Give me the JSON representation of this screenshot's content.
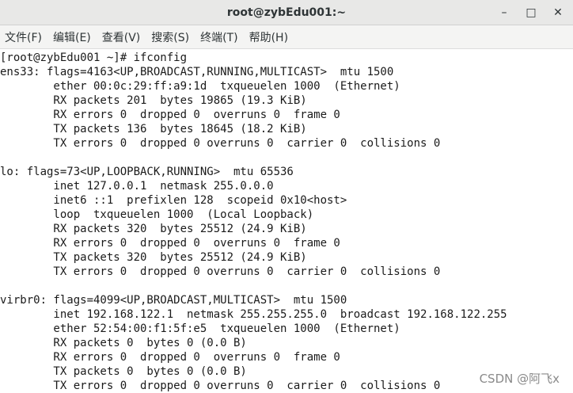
{
  "window": {
    "title": "root@zybEdu001:~",
    "minimize_glyph": "–",
    "maximize_glyph": "□",
    "close_glyph": "✕"
  },
  "menu": [
    "文件(F)",
    "编辑(E)",
    "查看(V)",
    "搜索(S)",
    "终端(T)",
    "帮助(H)"
  ],
  "terminal": {
    "lines": [
      "[root@zybEdu001 ~]# ifconfig",
      "ens33: flags=4163<UP,BROADCAST,RUNNING,MULTICAST>  mtu 1500",
      "        ether 00:0c:29:ff:a9:1d  txqueuelen 1000  (Ethernet)",
      "        RX packets 201  bytes 19865 (19.3 KiB)",
      "        RX errors 0  dropped 0  overruns 0  frame 0",
      "        TX packets 136  bytes 18645 (18.2 KiB)",
      "        TX errors 0  dropped 0 overruns 0  carrier 0  collisions 0",
      "",
      "lo: flags=73<UP,LOOPBACK,RUNNING>  mtu 65536",
      "        inet 127.0.0.1  netmask 255.0.0.0",
      "        inet6 ::1  prefixlen 128  scopeid 0x10<host>",
      "        loop  txqueuelen 1000  (Local Loopback)",
      "        RX packets 320  bytes 25512 (24.9 KiB)",
      "        RX errors 0  dropped 0  overruns 0  frame 0",
      "        TX packets 320  bytes 25512 (24.9 KiB)",
      "        TX errors 0  dropped 0 overruns 0  carrier 0  collisions 0",
      "",
      "virbr0: flags=4099<UP,BROADCAST,MULTICAST>  mtu 1500",
      "        inet 192.168.122.1  netmask 255.255.255.0  broadcast 192.168.122.255",
      "        ether 52:54:00:f1:5f:e5  txqueuelen 1000  (Ethernet)",
      "        RX packets 0  bytes 0 (0.0 B)",
      "        RX errors 0  dropped 0  overruns 0  frame 0",
      "        TX packets 0  bytes 0 (0.0 B)",
      "        TX errors 0  dropped 0 overruns 0  carrier 0  collisions 0"
    ]
  },
  "watermark": "CSDN @阿飞x"
}
